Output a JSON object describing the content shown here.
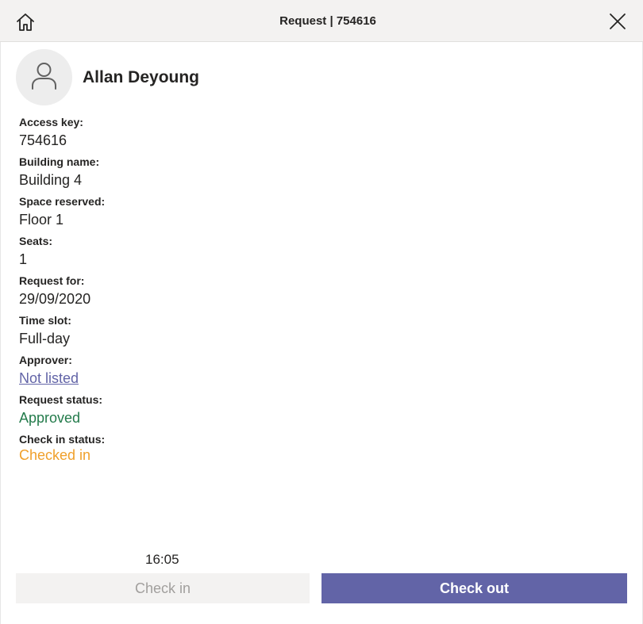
{
  "header": {
    "title": "Request | 754616",
    "home_icon": "home-icon",
    "close_icon": "close-icon"
  },
  "user": {
    "name": "Allan Deyoung",
    "avatar_icon": "person-icon"
  },
  "fields": {
    "access_key": {
      "label": "Access key:",
      "value": "754616"
    },
    "building_name": {
      "label": "Building name:",
      "value": "Building 4"
    },
    "space_reserved": {
      "label": "Space reserved:",
      "value": "Floor 1"
    },
    "seats": {
      "label": "Seats:",
      "value": "1"
    },
    "request_for": {
      "label": "Request for:",
      "value": "29/09/2020"
    },
    "time_slot": {
      "label": "Time slot:",
      "value": "Full-day"
    },
    "approver": {
      "label": "Approver:",
      "value": "Not listed"
    },
    "request_status": {
      "label": "Request status:",
      "value": "Approved"
    },
    "check_in_status": {
      "label": "Check in status:",
      "value": "Checked in"
    }
  },
  "footer": {
    "time": "16:05",
    "check_in_label": "Check in",
    "check_out_label": "Check out"
  },
  "colors": {
    "accent": "#6264a7",
    "approved": "#237b4b",
    "checked_in": "#f0a02b",
    "disabled_text": "#a19f9d"
  }
}
